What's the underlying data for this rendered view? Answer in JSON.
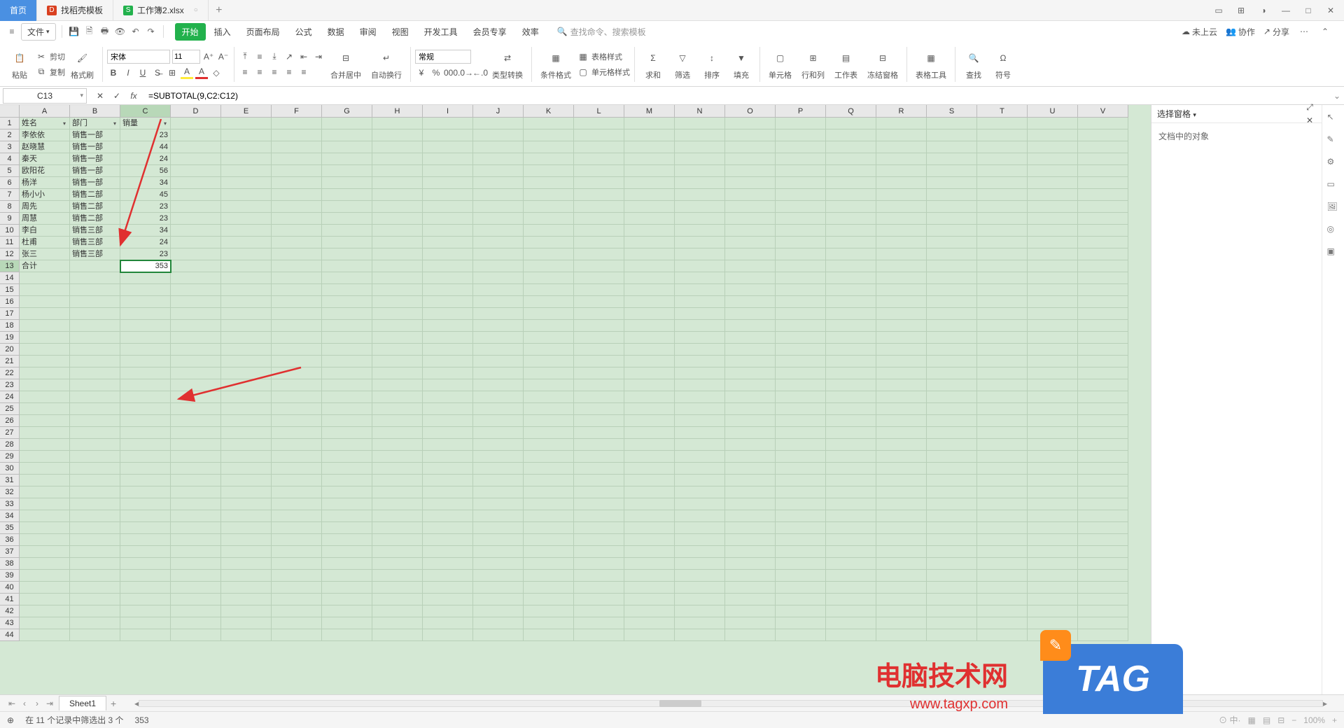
{
  "titlebar": {
    "tabs": [
      {
        "label": "首页",
        "active": true
      },
      {
        "label": "找稻壳模板",
        "icon": "#d94020"
      },
      {
        "label": "工作簿2.xlsx",
        "icon": "#22b14c"
      }
    ]
  },
  "menubar": {
    "file": "文件",
    "ribbon_tabs": [
      "开始",
      "插入",
      "页面布局",
      "公式",
      "数据",
      "审阅",
      "视图",
      "开发工具",
      "会员专享",
      "效率"
    ],
    "active_tab": "开始",
    "search_placeholder": "查找命令、搜索模板",
    "right": {
      "cloud": "未上云",
      "coop": "协作",
      "share": "分享"
    }
  },
  "ribbon": {
    "paste": "粘贴",
    "cut": "剪切",
    "copy": "复制",
    "format_paint": "格式刷",
    "font_name": "宋体",
    "font_size": "11",
    "merge": "合并居中",
    "wrap": "自动换行",
    "number_format": "常规",
    "type_convert": "类型转换",
    "cond_fmt": "条件格式",
    "cell_style": "单元格样式",
    "table_style": "表格样式",
    "sum": "求和",
    "filter": "筛选",
    "sort": "排序",
    "fill": "填充",
    "cell": "单元格",
    "row_col": "行和列",
    "sheet": "工作表",
    "freeze": "冻结窗格",
    "table_tool": "表格工具",
    "find": "查找",
    "symbol": "符号"
  },
  "formula_bar": {
    "name_box": "C13",
    "formula": "=SUBTOTAL(9,C2:C12)"
  },
  "columns": [
    "A",
    "B",
    "C",
    "D",
    "E",
    "F",
    "G",
    "H",
    "I",
    "J",
    "K",
    "L",
    "M",
    "N",
    "O",
    "P",
    "Q",
    "R",
    "S",
    "T",
    "U",
    "V"
  ],
  "selected_col_index": 2,
  "selected_row_index": 12,
  "row_count": 44,
  "sheet": {
    "headers": [
      "姓名",
      "部门",
      "销量"
    ],
    "rows": [
      [
        "李依依",
        "销售一部",
        "23"
      ],
      [
        "赵晓慧",
        "销售一部",
        "44"
      ],
      [
        "秦天",
        "销售一部",
        "24"
      ],
      [
        "欧阳花",
        "销售一部",
        "56"
      ],
      [
        "杨洋",
        "销售一部",
        "34"
      ],
      [
        "杨小小",
        "销售二部",
        "45"
      ],
      [
        "周先",
        "销售二部",
        "23"
      ],
      [
        "周慧",
        "销售二部",
        "23"
      ],
      [
        "李白",
        "销售三部",
        "34"
      ],
      [
        "杜甫",
        "销售三部",
        "24"
      ],
      [
        "张三",
        "销售三部",
        "23"
      ]
    ],
    "total_row": [
      "合计",
      "",
      "353"
    ]
  },
  "sheet_tabs": {
    "active": "Sheet1"
  },
  "status": {
    "text": "在 11 个记录中筛选出 3 个",
    "value": "353",
    "zoom": "100%"
  },
  "side_panel": {
    "title": "选择窗格",
    "body": "文档中的对象"
  },
  "watermark": {
    "line1": "电脑技术网",
    "line2": "www.tagxp.com",
    "tag": "TAG"
  }
}
